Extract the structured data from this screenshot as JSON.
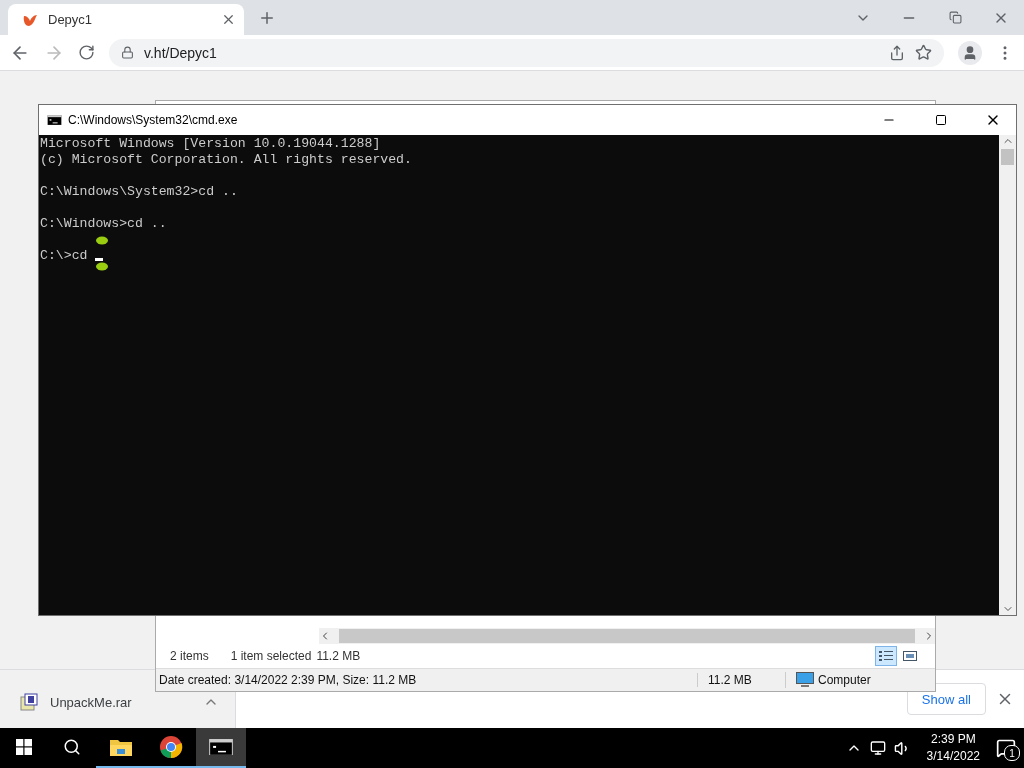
{
  "browser": {
    "tab": {
      "title": "Depyc1"
    },
    "address": "v.ht/Depyc1"
  },
  "cmd": {
    "title": "C:\\Windows\\System32\\cmd.exe",
    "lines": [
      "Microsoft Windows [Version 10.0.19044.1288]",
      "(c) Microsoft Corporation. All rights reserved.",
      "C:\\Windows\\System32>cd ..",
      "C:\\Windows>cd ..",
      "C:\\>cd"
    ]
  },
  "explorer": {
    "item_count": "2 items",
    "selection": "1 item selected",
    "selection_size": "11.2 MB",
    "details": "Date created: 3/14/2022 2:39 PM, Size: 11.2 MB",
    "size": "11.2 MB",
    "location": "Computer"
  },
  "downloads": {
    "file": "UnpackMe.rar",
    "show_all": "Show all"
  },
  "taskbar": {
    "apps": [
      {
        "kind": "explorer",
        "selected": false
      },
      {
        "kind": "chrome",
        "selected": false
      },
      {
        "kind": "cmd",
        "selected": true
      }
    ],
    "time": "2:39 PM",
    "date": "3/14/2022",
    "notifications": "1"
  }
}
